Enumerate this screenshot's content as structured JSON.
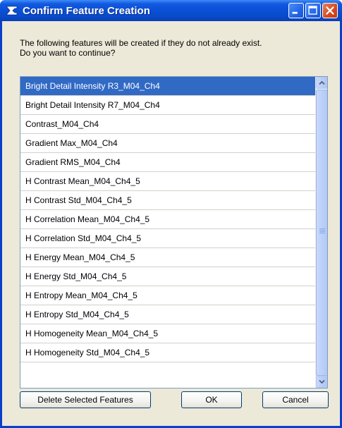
{
  "window": {
    "title": "Confirm Feature Creation",
    "icon": "sigma-icon",
    "controls": [
      "minimize",
      "maximize",
      "close"
    ]
  },
  "message": {
    "line1": "The following features will be created if they do not already exist.",
    "line2": "Do you want to continue?"
  },
  "features": [
    "Bright Detail Intensity R3_M04_Ch4",
    "Bright Detail Intensity R7_M04_Ch4",
    "Contrast_M04_Ch4",
    "Gradient Max_M04_Ch4",
    "Gradient RMS_M04_Ch4",
    "H Contrast Mean_M04_Ch4_5",
    "H Contrast Std_M04_Ch4_5",
    "H Correlation Mean_M04_Ch4_5",
    "H Correlation Std_M04_Ch4_5",
    "H Energy Mean_M04_Ch4_5",
    "H Energy Std_M04_Ch4_5",
    "H Entropy Mean_M04_Ch4_5",
    "H Entropy Std_M04_Ch4_5",
    "H Homogeneity Mean_M04_Ch4_5",
    "H Homogeneity Std_M04_Ch4_5"
  ],
  "selected_index": 0,
  "buttons": {
    "delete": "Delete Selected Features",
    "ok": "OK",
    "cancel": "Cancel"
  },
  "colors": {
    "titlebar": "#0850d6",
    "selection": "#316ac5",
    "dialog_face": "#ece9d8"
  }
}
